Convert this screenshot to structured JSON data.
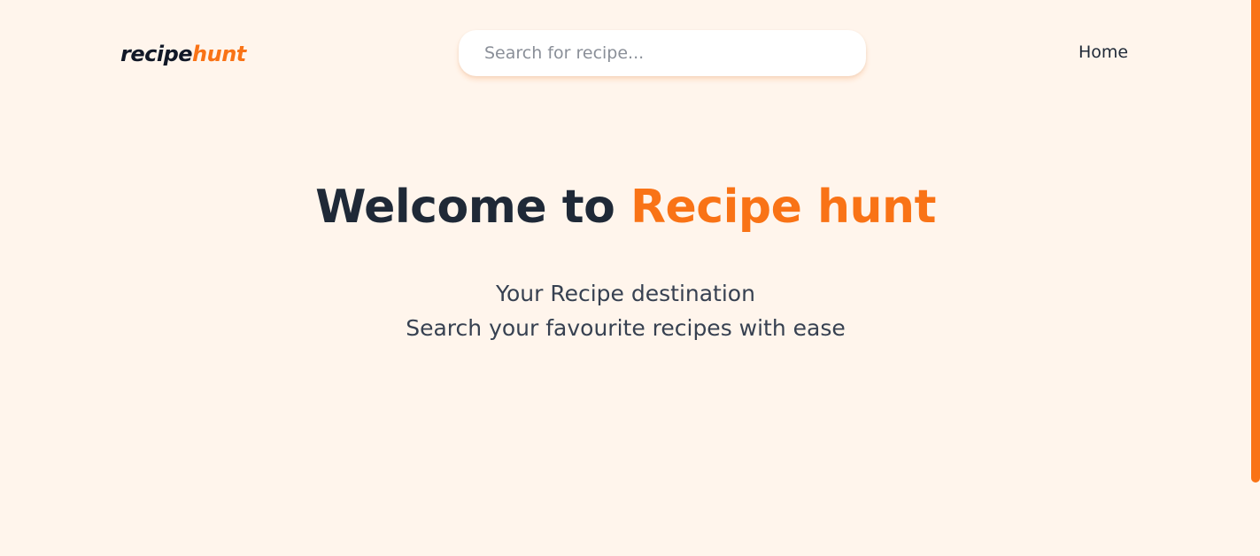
{
  "navbar": {
    "logo": {
      "part1": "recipe",
      "part2": "hunt"
    },
    "search": {
      "placeholder": "Search for recipe...",
      "value": ""
    },
    "links": {
      "home": "Home"
    }
  },
  "hero": {
    "title_prefix": "Welcome to ",
    "title_accent": "Recipe hunt",
    "subtitle_line1": "Your Recipe destination",
    "subtitle_line2": "Search your favourite recipes with ease"
  },
  "colors": {
    "background": "#fff5ec",
    "accent": "#f97316",
    "text_dark": "#1f2937"
  }
}
